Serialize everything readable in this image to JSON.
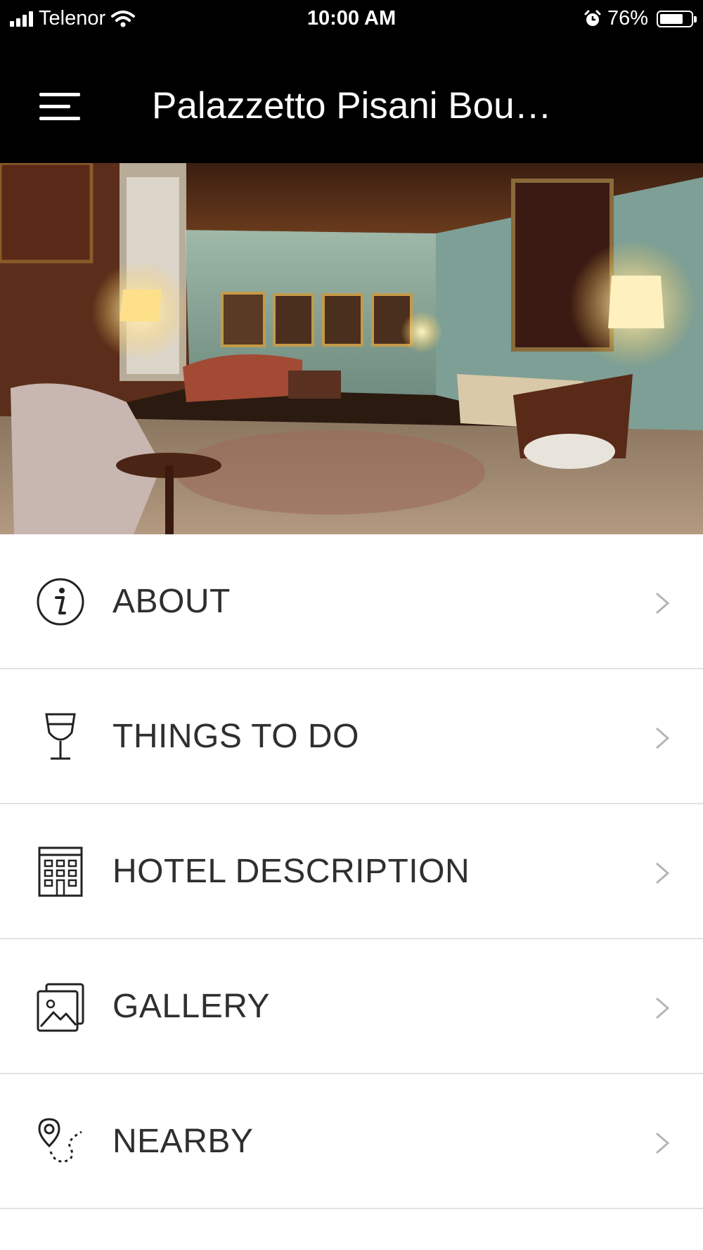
{
  "status_bar": {
    "carrier": "Telenor",
    "time": "10:00 AM",
    "battery": "76%",
    "battery_level": 0.76
  },
  "app_bar": {
    "title": "Palazzetto Pisani Bou…"
  },
  "menu": {
    "items": [
      {
        "label": "ABOUT",
        "icon": "info-icon"
      },
      {
        "label": "THINGS TO DO",
        "icon": "wine-glass-icon"
      },
      {
        "label": "HOTEL DESCRIPTION",
        "icon": "building-icon"
      },
      {
        "label": "GALLERY",
        "icon": "gallery-icon"
      },
      {
        "label": "NEARBY",
        "icon": "map-pin-route-icon"
      }
    ]
  },
  "colors": {
    "bar_background": "#000000",
    "item_text": "#2f2f2f",
    "divider": "#e2e2e2",
    "chevron": "#b5b5b5"
  }
}
